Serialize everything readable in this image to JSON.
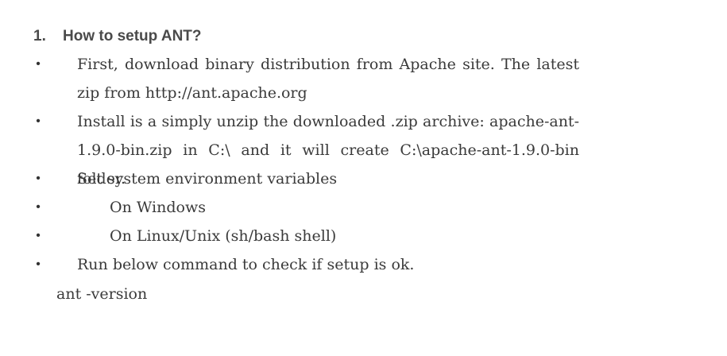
{
  "heading": {
    "number": "1.",
    "title": "How to setup ANT?"
  },
  "bullet_char": "•",
  "items": [
    {
      "text": "First, download binary distribution from Apache site. The latest zip from http://ant.apache.org"
    },
    {
      "text": "Install is a simply unzip the downloaded .zip archive: apache-ant-1.9.0-bin.zip in C:\\ and it will create C:\\apache-ant-1.9.0-bin folder."
    },
    {
      "text": "Set system environment variables"
    },
    {
      "text": "On Windows"
    },
    {
      "text": "On Linux/Unix (sh/bash shell)"
    },
    {
      "text": "Run below command to check if setup is ok."
    }
  ],
  "command": "ant -version"
}
